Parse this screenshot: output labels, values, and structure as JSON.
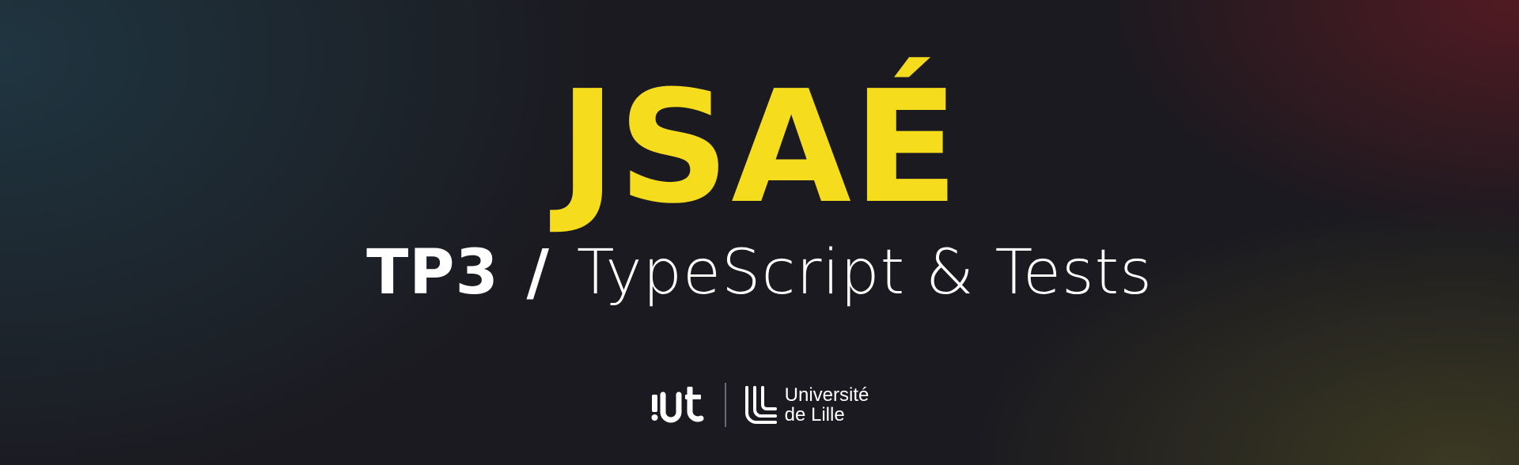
{
  "banner": {
    "title": "JSAÉ",
    "subtitle": {
      "tp": "TP3",
      "separator": "/",
      "topic": "TypeScript & Tests"
    },
    "logos": {
      "iut": "iut",
      "university": {
        "line1": "Université",
        "line2": "de Lille"
      }
    },
    "colors": {
      "accent": "#f5dc1d",
      "text": "#ffffff",
      "background": "#1b1a20"
    }
  }
}
